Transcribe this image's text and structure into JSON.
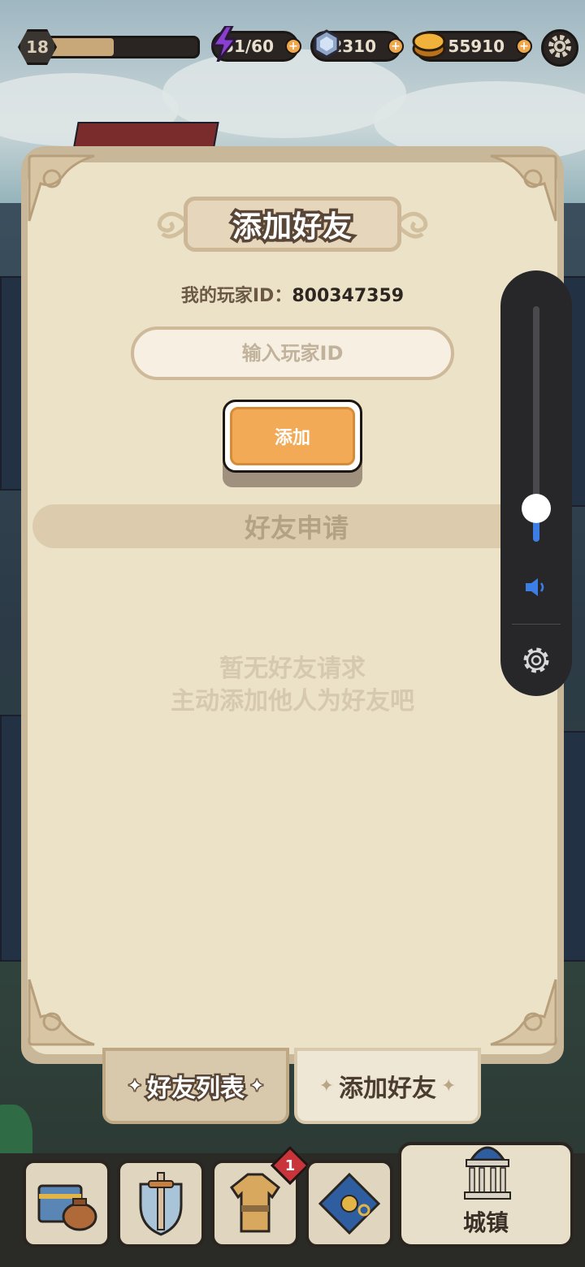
{
  "hud": {
    "level": "18",
    "level_progress": 0.45,
    "energy": "51/60",
    "gems": "2310",
    "coins": "55910",
    "icons": [
      "energy-bolt-icon",
      "gem-icon",
      "coin-icon",
      "gear-icon"
    ]
  },
  "dialog": {
    "title": "添加好友",
    "player_id_label": "我的玩家ID：",
    "player_id_value": "800347359",
    "input_placeholder": "输入玩家ID",
    "add_button": "添加",
    "section_title": "好友申请",
    "empty_line1": "暂无好友请求",
    "empty_line2": "主动添加他人为好友吧"
  },
  "tabs": {
    "friend_list": "好友列表",
    "add_friend": "添加好友",
    "active": "add_friend"
  },
  "bottom_nav": {
    "town_label": "城镇",
    "badge_count": "1",
    "icons": [
      "inventory-chest-icon",
      "sword-shield-icon",
      "armor-icon",
      "map-compass-icon",
      "town-hall-icon"
    ]
  },
  "volume": {
    "level": 0.14,
    "icons": [
      "speaker-icon",
      "settings-gear-icon"
    ]
  },
  "colors": {
    "accent_orange": "#f3aa56",
    "panel_bg": "#ebe2c8",
    "volume_accent": "#3d7de6"
  }
}
